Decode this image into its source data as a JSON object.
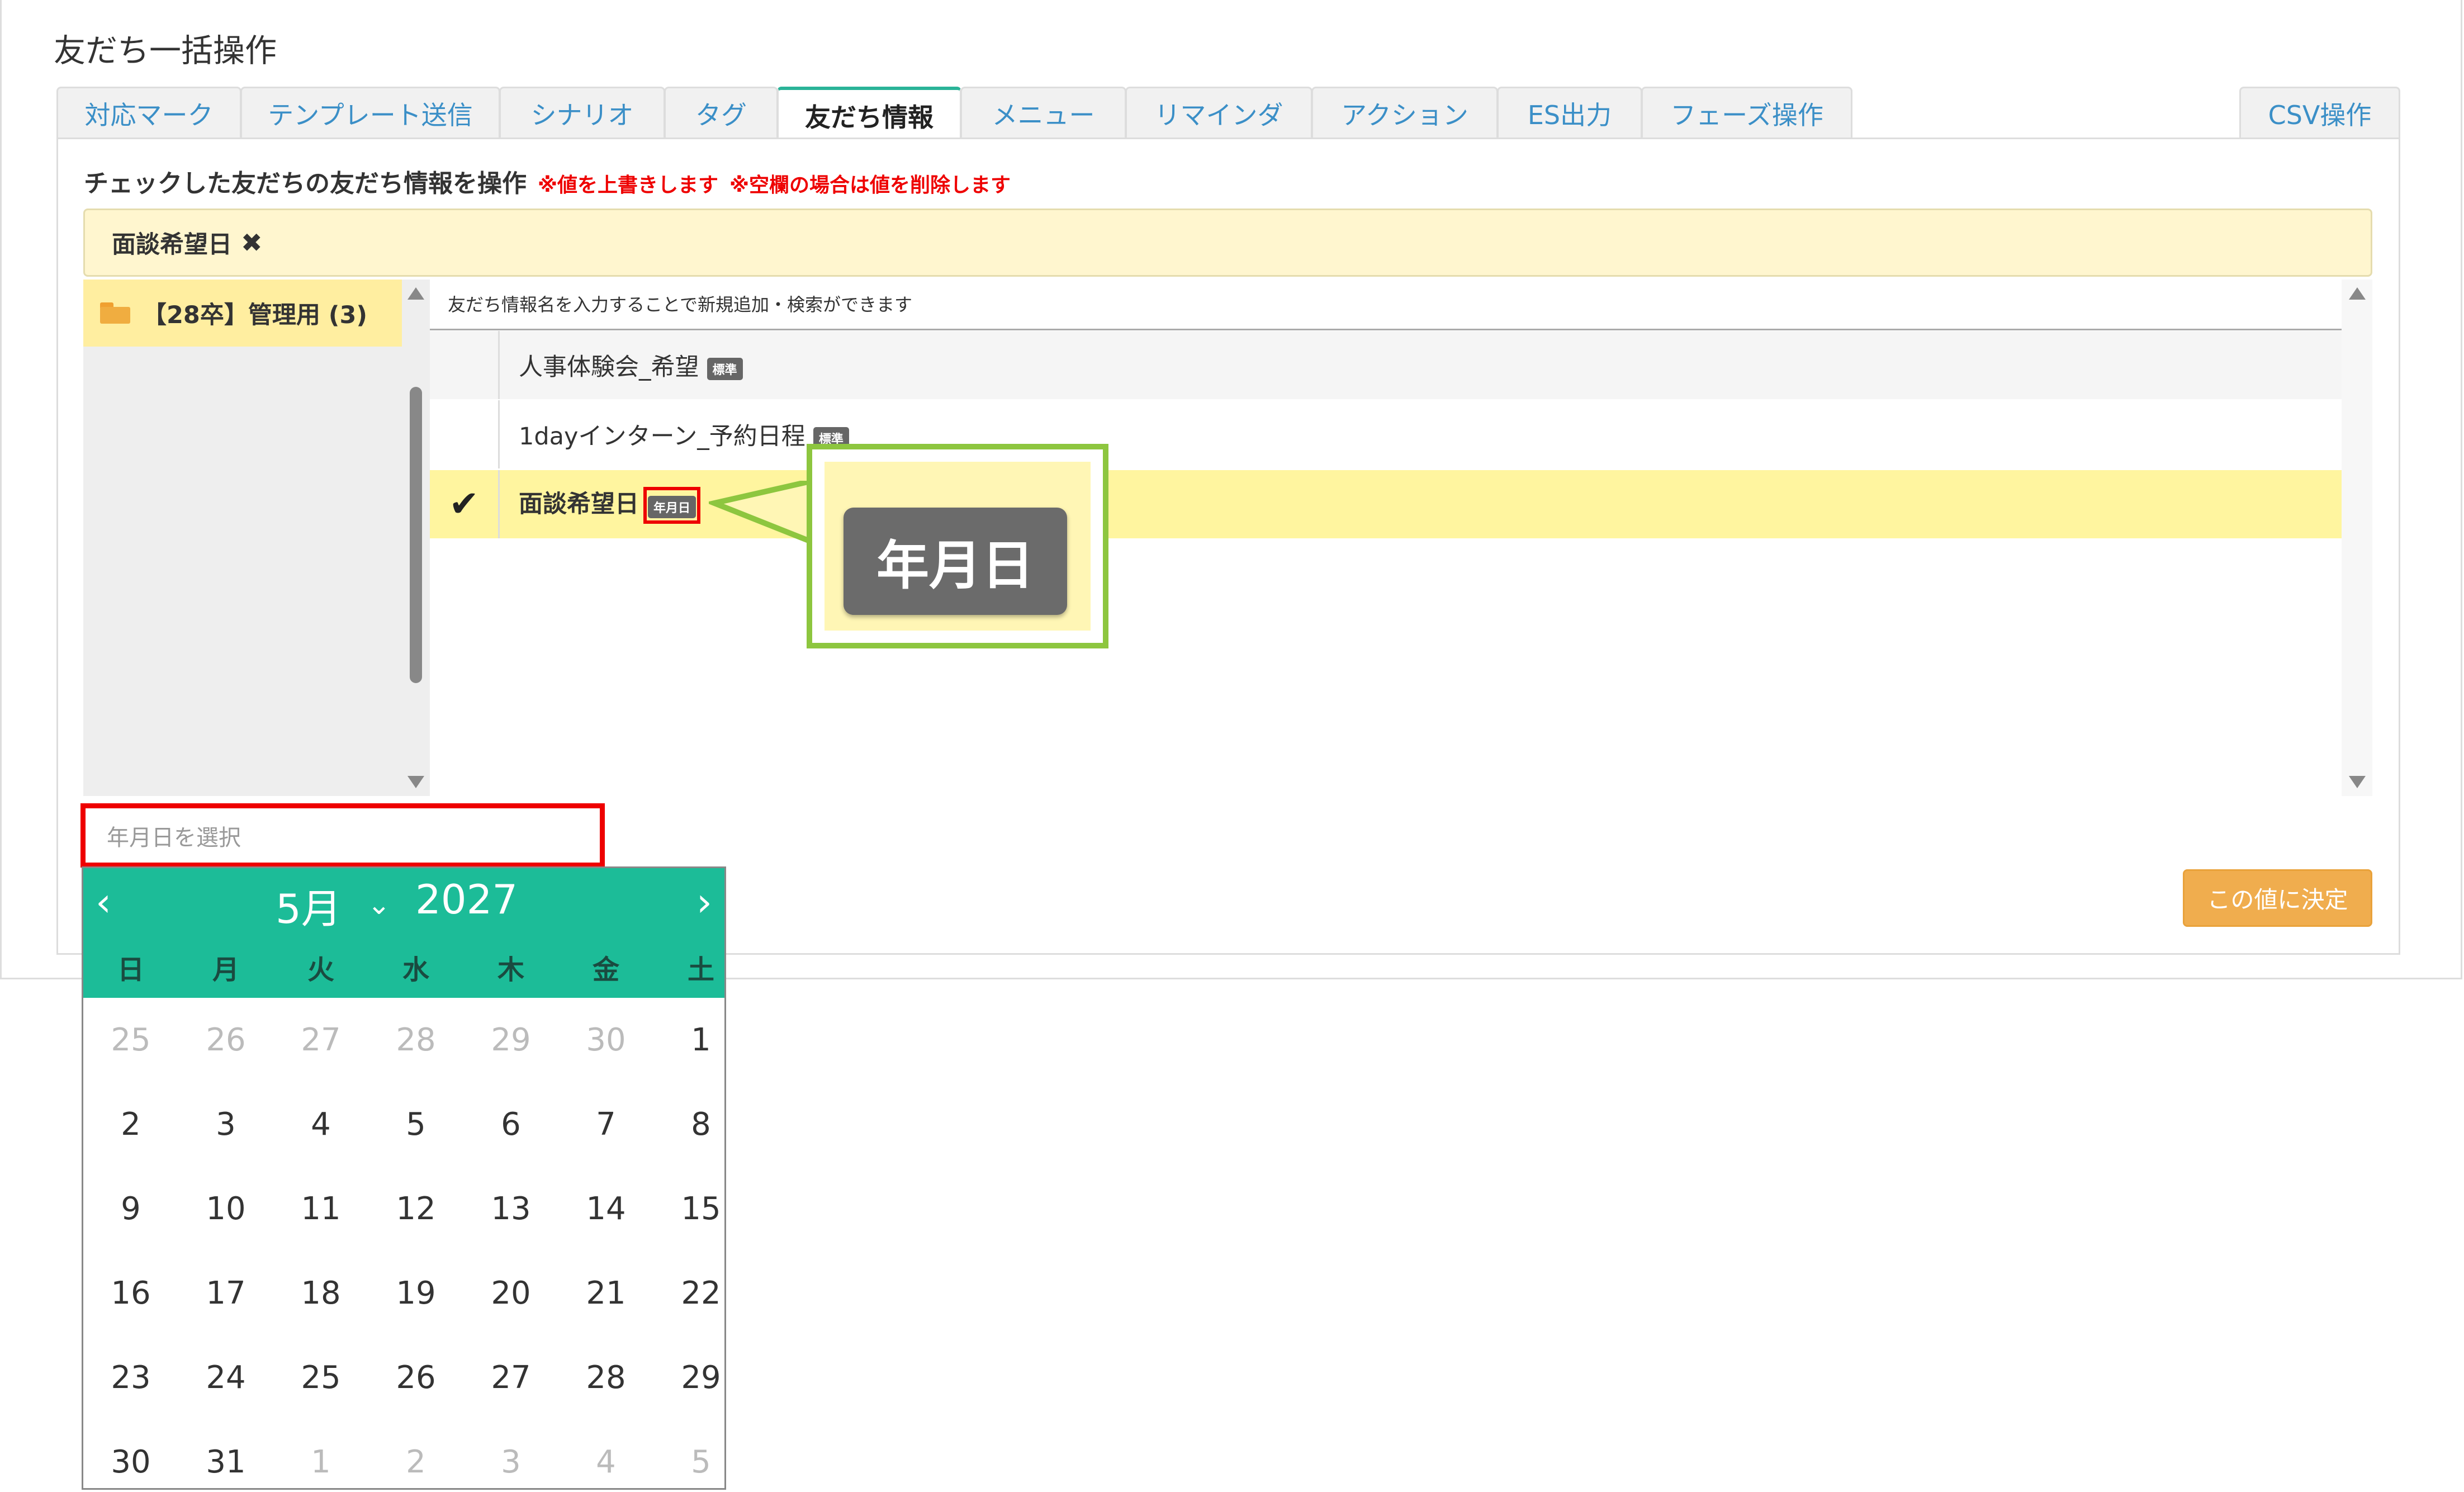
{
  "page_title": "友だち一括操作",
  "tabs": [
    {
      "label": "対応マーク"
    },
    {
      "label": "テンプレート送信"
    },
    {
      "label": "シナリオ"
    },
    {
      "label": "タグ"
    },
    {
      "label": "友だち情報",
      "active": true
    },
    {
      "label": "メニュー"
    },
    {
      "label": "リマインダ"
    },
    {
      "label": "アクション"
    },
    {
      "label": "ES出力"
    },
    {
      "label": "フェーズ操作"
    }
  ],
  "csv_tab": "CSV操作",
  "heading": "チェックした友だちの友だち情報を操作",
  "warning1": "※値を上書きします",
  "warning2": "※空欄の場合は値を削除します",
  "selected_field": {
    "label": "面談希望日",
    "close_icon": "✖"
  },
  "folder": {
    "label": "【28卒】管理用 (3)",
    "icon": "folder-open-icon"
  },
  "hint": "友だち情報名を入力することで新規追加・検索ができます",
  "fields": [
    {
      "name": "人事体験会_希望",
      "badge": "標準",
      "checked": false
    },
    {
      "name": "1dayインターン_予約日程",
      "badge": "標準",
      "checked": false
    },
    {
      "name": "面談希望日",
      "badge": "年月日",
      "checked": true
    }
  ],
  "check_glyph": "✔",
  "callout_badge": "年月日",
  "date_input": {
    "placeholder": "年月日を選択"
  },
  "decide_button": "この値に決定",
  "calendar": {
    "month": "5月",
    "year": "2027",
    "prev": "‹",
    "next": "›",
    "chevron": "⌄",
    "weekdays": [
      "日",
      "月",
      "火",
      "水",
      "木",
      "金",
      "土"
    ],
    "weeks": [
      [
        {
          "d": "25",
          "m": true
        },
        {
          "d": "26",
          "m": true
        },
        {
          "d": "27",
          "m": true
        },
        {
          "d": "28",
          "m": true
        },
        {
          "d": "29",
          "m": true
        },
        {
          "d": "30",
          "m": true
        },
        {
          "d": "1"
        }
      ],
      [
        {
          "d": "2"
        },
        {
          "d": "3"
        },
        {
          "d": "4"
        },
        {
          "d": "5"
        },
        {
          "d": "6"
        },
        {
          "d": "7"
        },
        {
          "d": "8"
        }
      ],
      [
        {
          "d": "9"
        },
        {
          "d": "10"
        },
        {
          "d": "11"
        },
        {
          "d": "12"
        },
        {
          "d": "13"
        },
        {
          "d": "14"
        },
        {
          "d": "15"
        }
      ],
      [
        {
          "d": "16"
        },
        {
          "d": "17"
        },
        {
          "d": "18"
        },
        {
          "d": "19"
        },
        {
          "d": "20"
        },
        {
          "d": "21"
        },
        {
          "d": "22"
        }
      ],
      [
        {
          "d": "23"
        },
        {
          "d": "24"
        },
        {
          "d": "25"
        },
        {
          "d": "26"
        },
        {
          "d": "27"
        },
        {
          "d": "28"
        },
        {
          "d": "29"
        }
      ],
      [
        {
          "d": "30"
        },
        {
          "d": "31"
        },
        {
          "d": "1",
          "m": true
        },
        {
          "d": "2",
          "m": true
        },
        {
          "d": "3",
          "m": true
        },
        {
          "d": "4",
          "m": true
        },
        {
          "d": "5",
          "m": true
        }
      ]
    ]
  },
  "colors": {
    "accent": "#1cbc98",
    "highlight": "#fff59f",
    "warning": "#ee0000",
    "button": "#f0ad4e",
    "callout_border": "#8dc63f"
  }
}
